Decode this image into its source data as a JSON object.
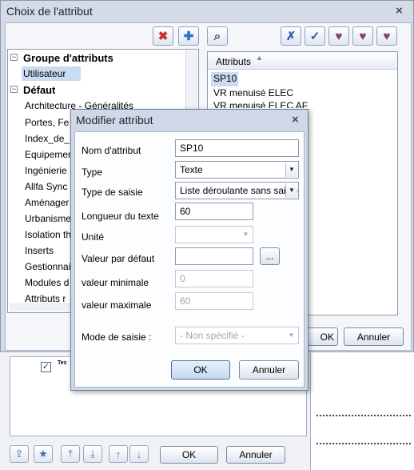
{
  "outer": {
    "title": "Choix de l'attribut",
    "close_icon": "×",
    "toolbar": [
      {
        "icon": "delete-icon",
        "glyph": "✖",
        "color": "#d02a2a"
      },
      {
        "icon": "add-icon",
        "glyph": "✚",
        "color": "#2a6fd0"
      },
      {
        "icon": "search-icon",
        "glyph": "⌕",
        "color": "#3a4a66"
      },
      {
        "icon": "uncheck-all-icon",
        "glyph": "✗",
        "color": "#2a5fb0"
      },
      {
        "icon": "check-all-icon",
        "glyph": "✓",
        "color": "#2a5fb0"
      },
      {
        "icon": "favorite-add-icon",
        "glyph": "♥",
        "color": "#8a3b6a"
      },
      {
        "icon": "favorite-check-icon",
        "glyph": "♥",
        "color": "#8a3b6a"
      },
      {
        "icon": "favorite-remove-icon",
        "glyph": "♥",
        "color": "#8a3b6a"
      }
    ],
    "tree": {
      "group1": "Groupe d'attributs",
      "group1_expander": "−",
      "selected_item": "Utilisateur",
      "group2": "Défaut",
      "group2_expander": "−",
      "items": [
        "Architecture - Généralités",
        "Portes, Fe",
        "Index_de_",
        "Equipemen",
        "Ingénierie",
        "Allfa Sync",
        "Aménager",
        "Urbanisme",
        "Isolation th",
        "Inserts",
        "Gestionnai",
        "Modules d",
        "Attributs r"
      ]
    },
    "attributes": {
      "header": "Attributs",
      "sort_arrow": "▲",
      "items": [
        "SP10",
        "VR menuisé ELEC",
        "VR menuisé ELEC AF"
      ]
    },
    "ok_label": "OK",
    "cancel_label": "Annuler"
  },
  "lower": {
    "check_glyph": "✓",
    "tex_label": "Tex",
    "ok_label": "OK",
    "cancel_label": "Annuler",
    "icons": [
      {
        "name": "import-icon",
        "glyph": "⇪"
      },
      {
        "name": "favorite-star-icon",
        "glyph": "★"
      },
      {
        "name": "move-top-icon",
        "glyph": "⤒"
      },
      {
        "name": "move-bottom-icon",
        "glyph": "⤓"
      },
      {
        "name": "move-up-icon",
        "glyph": "↑"
      },
      {
        "name": "move-down-icon",
        "glyph": "↓"
      }
    ]
  },
  "modal": {
    "title": "Modifier attribut",
    "close_icon": "×",
    "fields": {
      "nom": {
        "label": "Nom d'attribut",
        "value": "SP10"
      },
      "type": {
        "label": "Type",
        "value": "Texte"
      },
      "type_saisie": {
        "label": "Type de saisie",
        "value": "Liste déroulante sans saisie"
      },
      "longueur": {
        "label": "Longueur du texte",
        "value": "60"
      },
      "unite": {
        "label": "Unité",
        "value": ""
      },
      "defaut": {
        "label": "Valeur par défaut",
        "value": "",
        "browse": "..."
      },
      "min": {
        "label": "valeur minimale",
        "value": "0"
      },
      "max": {
        "label": "valeur maximale",
        "value": "60"
      },
      "mode": {
        "label": "Mode de saisie :",
        "value": "- Non spécifié -"
      }
    },
    "dropdown_arrow": "▼",
    "ok_label": "OK",
    "cancel_label": "Annuler"
  }
}
